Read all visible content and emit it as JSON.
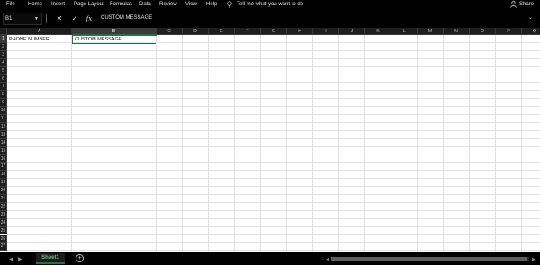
{
  "menu": {
    "items": [
      "File",
      "Home",
      "Insert",
      "Page Layout",
      "Formulas",
      "Data",
      "Review",
      "View",
      "Help"
    ],
    "tell_me": "Tell me what you want to do",
    "share": "Share"
  },
  "formula_bar": {
    "name_box": "B1",
    "formula_value": "CUSTOM MESSAGE",
    "fx_label": "fx"
  },
  "grid": {
    "columns": [
      "A",
      "B",
      "C",
      "D",
      "E",
      "F",
      "G",
      "H",
      "I",
      "J",
      "K",
      "L",
      "M",
      "N",
      "O",
      "P",
      "Q"
    ],
    "rows": [
      "1",
      "2",
      "3",
      "4",
      "5",
      "6",
      "7",
      "8",
      "9",
      "10",
      "11",
      "12",
      "13",
      "14",
      "15",
      "16",
      "17",
      "18",
      "19",
      "20",
      "21",
      "22",
      "23",
      "24",
      "25",
      "26",
      "27"
    ],
    "active_column": "B",
    "active_row": "1",
    "cells": {
      "A1": "PHONE NUMBER",
      "B1": "CUSTOM MESSAGE"
    }
  },
  "sheets": {
    "tabs": [
      "Sheet1"
    ],
    "active": "Sheet1"
  },
  "colors": {
    "accent": "#217346",
    "background": "#000000",
    "grid_background": "#ffffff"
  }
}
